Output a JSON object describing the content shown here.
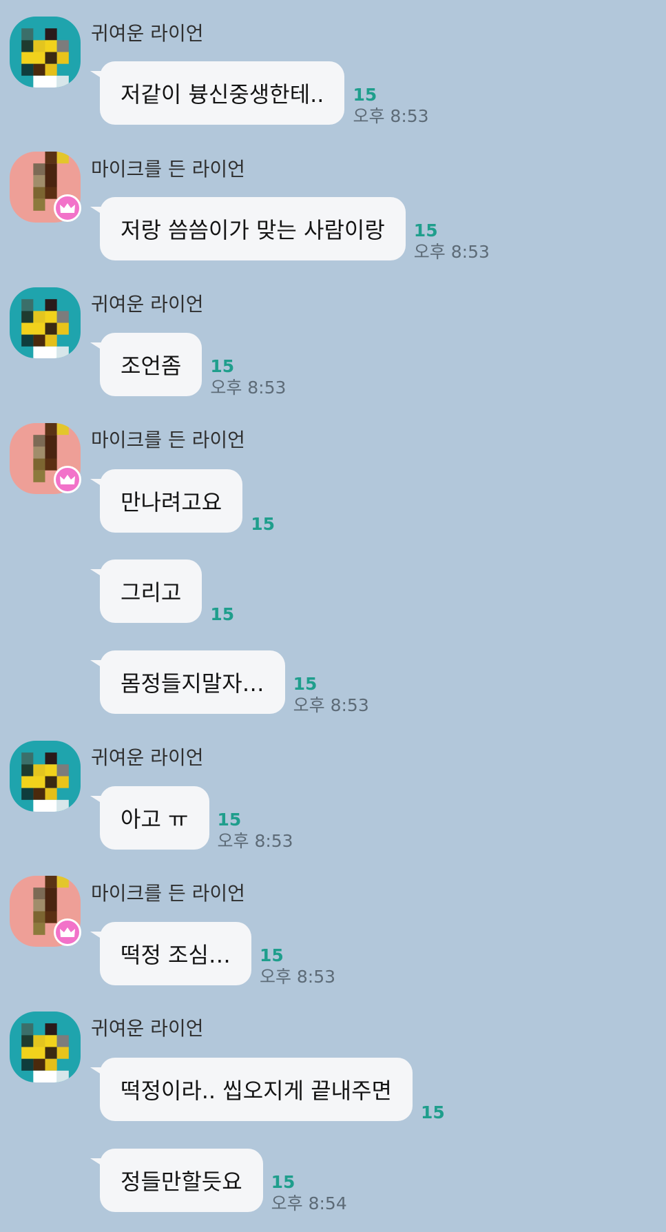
{
  "colors": {
    "background": "#b2c7da",
    "bubble": "#f5f6f8",
    "unread": "#1f9e8c",
    "crown_badge": "#f272c9"
  },
  "icons": {
    "avatar_1": "pixelated-teal-avatar",
    "avatar_2": "pixelated-pink-avatar",
    "badge": "crown-icon"
  },
  "messages": [
    {
      "sender": "귀여운 라이언",
      "text": "저같이 븅신중생한테..",
      "unread": "15",
      "time": "오후 8:53"
    },
    {
      "sender": "마이크를 든 라이언",
      "text": "저랑 씀씀이가 맞는 사람이랑",
      "unread": "15",
      "time": "오후 8:53"
    },
    {
      "sender": "귀여운 라이언",
      "text": "조언좀",
      "unread": "15",
      "time": "오후 8:53"
    },
    {
      "sender": "마이크를 든 라이언",
      "text": "만나려고요",
      "unread": "15"
    },
    {
      "text": "그리고",
      "unread": "15"
    },
    {
      "text": "몸정들지말자…",
      "unread": "15",
      "time": "오후 8:53"
    },
    {
      "sender": "귀여운 라이언",
      "text": "아고 ㅠ",
      "unread": "15",
      "time": "오후 8:53"
    },
    {
      "sender": "마이크를 든 라이언",
      "text": "떡정 조심…",
      "unread": "15",
      "time": "오후 8:53"
    },
    {
      "sender": "귀여운 라이언",
      "text": "떡정이라.. 씹오지게 끝내주면",
      "unread": "15"
    },
    {
      "text": "정들만할듯요",
      "unread": "15",
      "time": "오후 8:54"
    }
  ]
}
